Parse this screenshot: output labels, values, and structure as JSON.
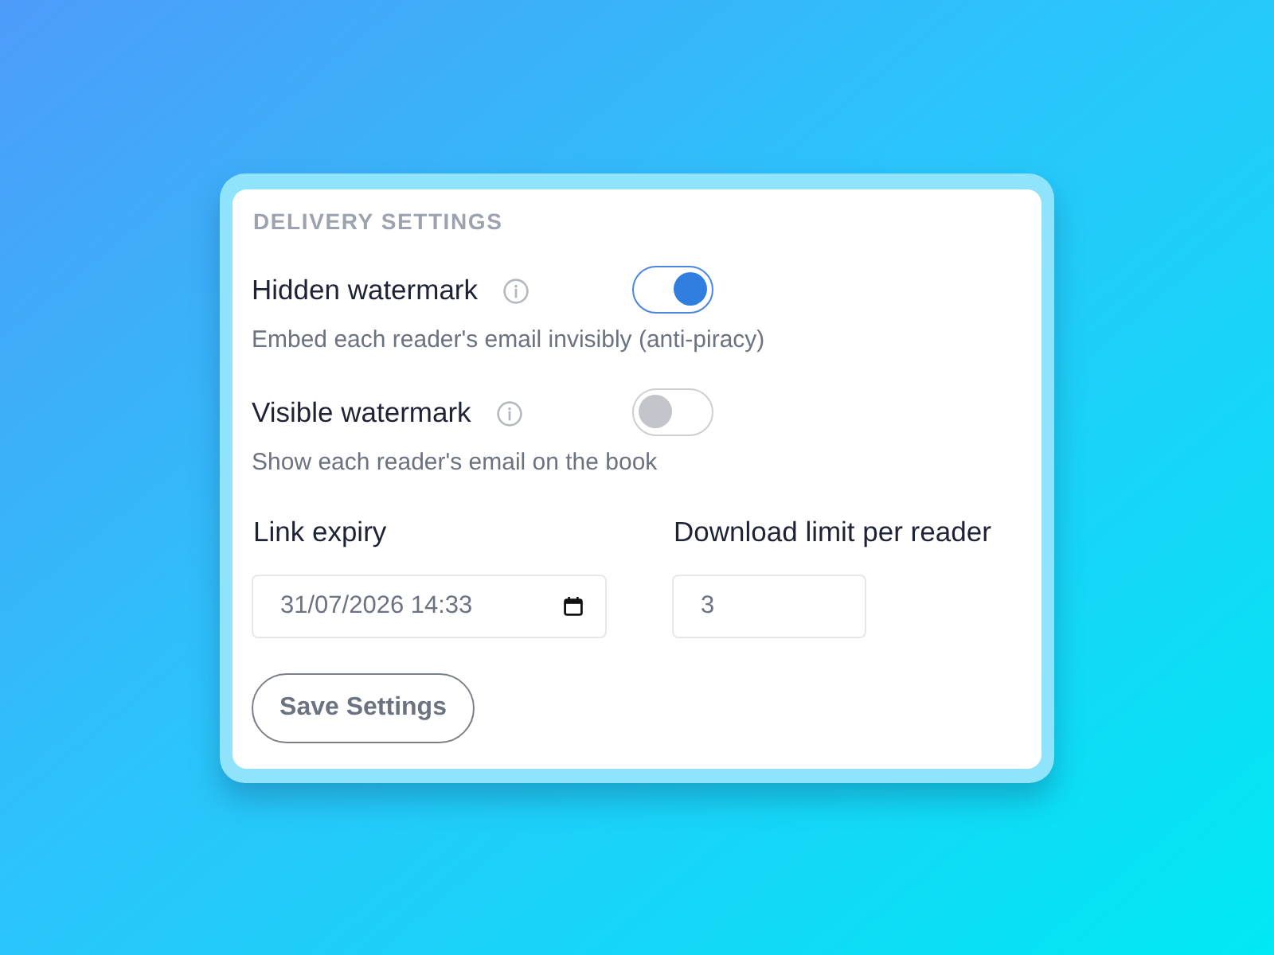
{
  "section_title": "DELIVERY SETTINGS",
  "toggles": [
    {
      "label": "Hidden watermark",
      "on": true,
      "description": "Embed each reader's email invisibly (anti-piracy)"
    },
    {
      "label": "Visible watermark",
      "on": false,
      "description": "Show each reader's email on the book"
    }
  ],
  "fields": [
    {
      "kind": "datetime",
      "label": "Link expiry",
      "value": "31/07/2026 14:33"
    },
    {
      "kind": "number",
      "label": "Download limit per reader",
      "value": "3"
    }
  ],
  "buttons": [
    {
      "label": "Save Settings"
    }
  ]
}
